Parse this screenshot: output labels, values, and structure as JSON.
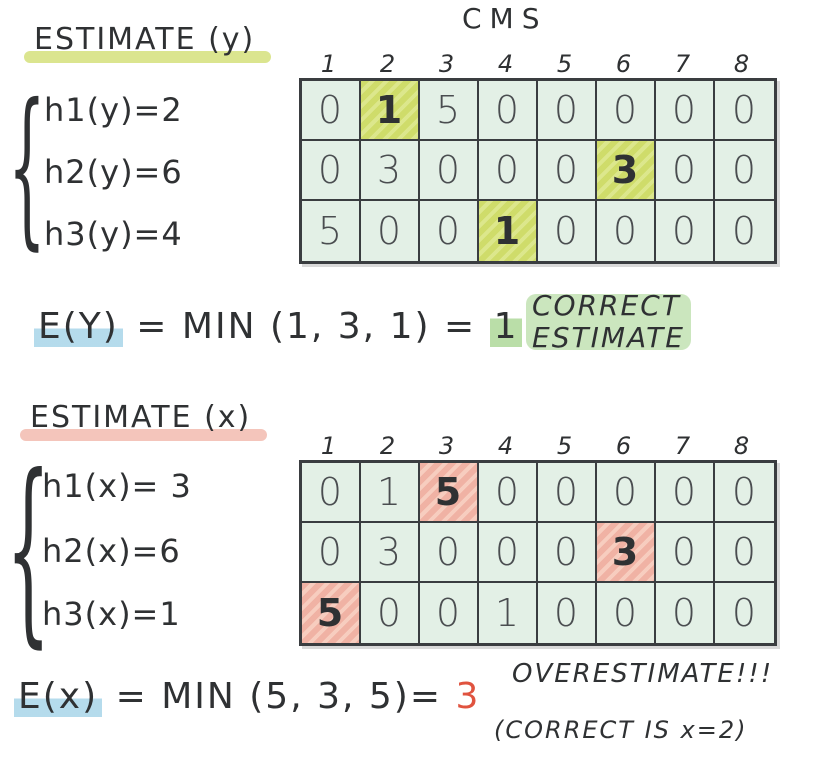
{
  "cms_title": "CMS",
  "columns": [
    "1",
    "2",
    "3",
    "4",
    "5",
    "6",
    "7",
    "8"
  ],
  "colors": {
    "y_accent": "#cfdc6a",
    "x_accent": "#f0b2a4",
    "cell_bg": "#e3f0e6",
    "formula_underline": "#78bedc",
    "correct_green": "#8cc86e",
    "overestimate_red": "#e0533f"
  },
  "y_section": {
    "heading": "ESTIMATE (y)",
    "hashes": [
      {
        "label": "h1(y)=2"
      },
      {
        "label": "h2(y)=6"
      },
      {
        "label": "h3(y)=4"
      }
    ],
    "grid": [
      [
        "0",
        "1",
        "5",
        "0",
        "0",
        "0",
        "0",
        "0"
      ],
      [
        "0",
        "3",
        "0",
        "0",
        "0",
        "3",
        "0",
        "0"
      ],
      [
        "5",
        "0",
        "0",
        "1",
        "0",
        "0",
        "0",
        "0"
      ]
    ],
    "highlight_cells": [
      [
        0,
        1
      ],
      [
        1,
        5
      ],
      [
        2,
        3
      ]
    ],
    "formula_lhs": "E(Y)",
    "formula_mid": "= MIN (1, 3, 1) =",
    "formula_result": "1",
    "note_line1": "CORRECT",
    "note_line2": "ESTIMATE"
  },
  "x_section": {
    "heading": "ESTIMATE (x)",
    "hashes": [
      {
        "label": "h1(x)= 3"
      },
      {
        "label": "h2(x)=6"
      },
      {
        "label": "h3(x)=1"
      }
    ],
    "grid": [
      [
        "0",
        "1",
        "5",
        "0",
        "0",
        "0",
        "0",
        "0"
      ],
      [
        "0",
        "3",
        "0",
        "0",
        "0",
        "3",
        "0",
        "0"
      ],
      [
        "5",
        "0",
        "0",
        "1",
        "0",
        "0",
        "0",
        "0"
      ]
    ],
    "highlight_cells": [
      [
        0,
        2
      ],
      [
        1,
        5
      ],
      [
        2,
        0
      ]
    ],
    "formula_lhs": "E(x)",
    "formula_mid": "= MIN (5, 3, 5)=",
    "formula_result": "3",
    "note_line1": "OVERESTIMATE!!!",
    "note_line2": "(CORRECT IS  x=2)"
  }
}
